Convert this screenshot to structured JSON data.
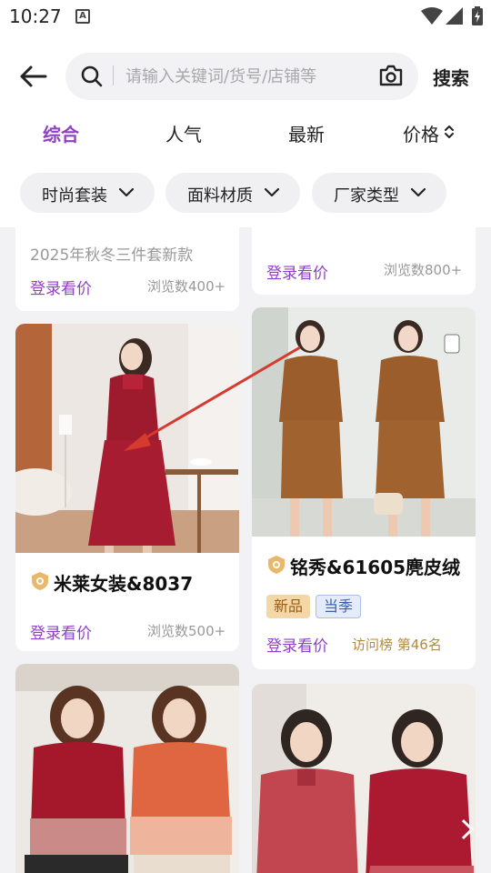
{
  "status_bar": {
    "time": "10:27",
    "a_icon": "A"
  },
  "header": {
    "search_placeholder": "请输入关键词/货号/店铺等",
    "search_button": "搜索"
  },
  "tabs": [
    {
      "label": "综合",
      "active": true
    },
    {
      "label": "人气"
    },
    {
      "label": "最新"
    },
    {
      "label": "价格"
    }
  ],
  "filters": [
    {
      "label": "时尚套装"
    },
    {
      "label": "面料材质"
    },
    {
      "label": "厂家类型"
    }
  ],
  "products": [
    {
      "subtitle": "2025年秋冬三件套新款",
      "login": "登录看价",
      "views": "浏览数400+"
    },
    {
      "login": "登录看价",
      "views": "浏览数800+"
    },
    {
      "name": "米莱女装&8037",
      "login": "登录看价",
      "views": "浏览数500+"
    },
    {
      "name": "铭秀&61605麂皮绒",
      "tags": [
        "新品",
        "当季"
      ],
      "login": "登录看价",
      "rank": "访问榜 第46名"
    }
  ],
  "colors": {
    "accent": "#8e3fc6",
    "annotation_arrow": "#d63a2f"
  }
}
